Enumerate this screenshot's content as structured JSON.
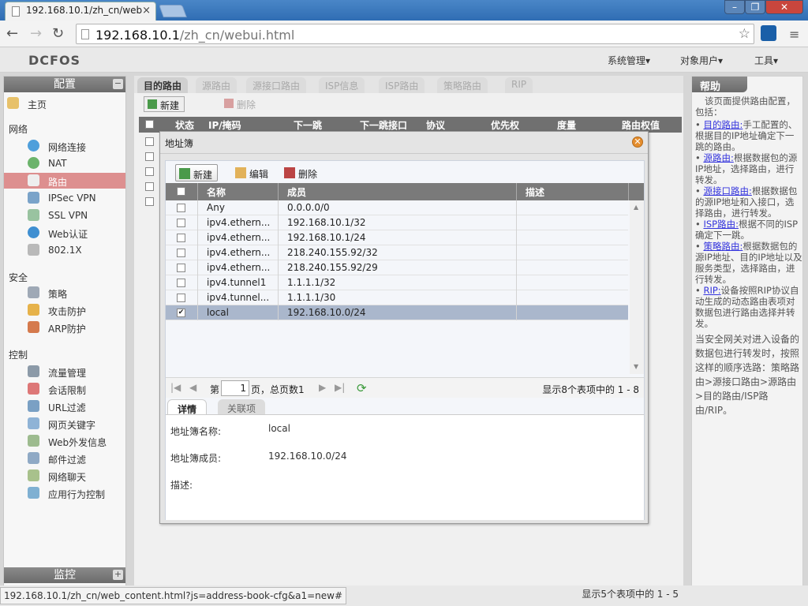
{
  "browser": {
    "tab_title": "192.168.10.1/zh_cn/web",
    "url_host": "192.168.10.1",
    "url_path": "/zh_cn/webui.html",
    "status_url": "192.168.10.1/zh_cn/web_content.html?js=address-book-cfg&a1=new#"
  },
  "app": {
    "logo": "DCFOS",
    "menus": [
      "系统管理",
      "对象用户",
      "工具"
    ]
  },
  "sidebar": {
    "title": "配置",
    "home": "主页",
    "sections": [
      {
        "title": "网络",
        "items": [
          "网络连接",
          "NAT",
          "路由",
          "IPSec VPN",
          "SSL VPN",
          "Web认证",
          "802.1X"
        ]
      },
      {
        "title": "安全",
        "items": [
          "策略",
          "攻击防护",
          "ARP防护"
        ]
      },
      {
        "title": "控制",
        "items": [
          "流量管理",
          "会话限制",
          "URL过滤",
          "网页关键字",
          "Web外发信息",
          "邮件过滤",
          "网络聊天",
          "应用行为控制"
        ]
      }
    ],
    "selected": "路由",
    "monitor": "监控"
  },
  "content": {
    "tabs": [
      "目的路由",
      "源路由",
      "源接口路由",
      "ISP信息",
      "ISP路由",
      "策略路由",
      "RIP"
    ],
    "new_btn": "新建",
    "delete_btn": "删除",
    "columns": [
      "状态",
      "IP/掩码",
      "下一跳",
      "下一跳接口",
      "协议",
      "优先权",
      "度量",
      "路由权值"
    ],
    "summary": "显示5个表项中的 1 - 5"
  },
  "dialog": {
    "title": "地址簿",
    "toolbar": {
      "new": "新建",
      "edit": "编辑",
      "delete": "删除"
    },
    "columns": {
      "name": "名称",
      "member": "成员",
      "desc": "描述"
    },
    "rows": [
      {
        "name": "Any",
        "member": "0.0.0.0/0",
        "checked": false
      },
      {
        "name": "ipv4.ethern...",
        "member": "192.168.10.1/32",
        "checked": false
      },
      {
        "name": "ipv4.ethern...",
        "member": "192.168.10.1/24",
        "checked": false
      },
      {
        "name": "ipv4.ethern...",
        "member": "218.240.155.92/32",
        "checked": false
      },
      {
        "name": "ipv4.ethern...",
        "member": "218.240.155.92/29",
        "checked": false
      },
      {
        "name": "ipv4.tunnel1",
        "member": "1.1.1.1/32",
        "checked": false
      },
      {
        "name": "ipv4.tunnel...",
        "member": "1.1.1.1/30",
        "checked": false
      },
      {
        "name": "local",
        "member": "192.168.10.0/24",
        "checked": true
      }
    ],
    "pager": {
      "prefix": "第",
      "page": "1",
      "suffix": "页，总页数1",
      "summary": "显示8个表项中的 1 - 8"
    },
    "detail_tabs": [
      "详情",
      "关联项"
    ],
    "detail": {
      "name_label": "地址簿名称:",
      "name_value": "local",
      "member_label": "地址簿成员:",
      "member_value": "192.168.10.0/24",
      "desc_label": "描述:"
    }
  },
  "help": {
    "title": "帮助",
    "intro": "该页面提供路由配置，包括：",
    "entries": [
      {
        "link": "目的路由:",
        "text": "手工配置的、根据目的IP地址确定下一跳的路由。"
      },
      {
        "link": "源路由:",
        "text": "根据数据包的源IP地址，选择路由，进行转发。"
      },
      {
        "link": "源接口路由:",
        "text": "根据数据包的源IP地址和入接口，选择路由，进行转发。"
      },
      {
        "link": "ISP路由:",
        "text": "根据不同的ISP确定下一跳。"
      },
      {
        "link": "策略路由:",
        "text": "根据数据包的源IP地址、目的IP地址以及服务类型，选择路由，进行转发。"
      },
      {
        "link": "RIP:",
        "text": "设备按照RIP协议自动生成的动态路由表项对数据包进行路由选择并转发。"
      }
    ],
    "footer": "当安全网关对进入设备的数据包进行转发时，按照这样的顺序选路：策略路由>源接口路由>源路由>目的路由/ISP路由/RIP。"
  }
}
